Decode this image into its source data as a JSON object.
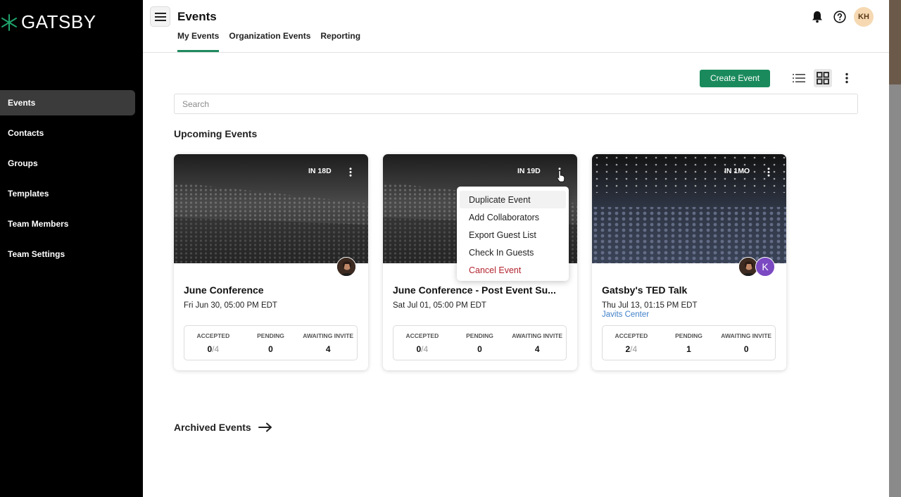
{
  "brand": {
    "name": "GATSBY",
    "accent": "#1a8a5c"
  },
  "sidebar": {
    "items": [
      {
        "label": "Events",
        "active": true
      },
      {
        "label": "Contacts"
      },
      {
        "label": "Groups"
      },
      {
        "label": "Templates"
      },
      {
        "label": "Team Members"
      },
      {
        "label": "Team Settings"
      }
    ]
  },
  "header": {
    "title": "Events",
    "tabs": [
      {
        "label": "My Events",
        "active": true
      },
      {
        "label": "Organization Events"
      },
      {
        "label": "Reporting"
      }
    ],
    "user_initials": "KH",
    "icons": [
      "menu-icon",
      "bell-icon",
      "help-icon"
    ]
  },
  "toolbar": {
    "create_label": "Create Event",
    "views": [
      "list-view-icon",
      "grid-view-icon",
      "more-icon"
    ],
    "active_view": "grid"
  },
  "search": {
    "placeholder": "Search",
    "value": ""
  },
  "upcoming": {
    "title": "Upcoming Events",
    "cards": [
      {
        "badge": "IN 18D",
        "title": "June Conference",
        "date": "Fri Jun 30, 05:00 PM EDT",
        "location": "",
        "avatars": [
          "photo"
        ],
        "stats": [
          {
            "label": "ACCEPTED",
            "value": "0",
            "total": "/4"
          },
          {
            "label": "PENDING",
            "value": "0"
          },
          {
            "label": "AWAITING INVITE",
            "value": "4"
          }
        ]
      },
      {
        "badge": "IN 19D",
        "title": "June Conference - Post Event Su...",
        "date": "Sat Jul 01, 05:00 PM EDT",
        "location": "",
        "avatars": [],
        "stats": [
          {
            "label": "ACCEPTED",
            "value": "0",
            "total": "/4"
          },
          {
            "label": "PENDING",
            "value": "0"
          },
          {
            "label": "AWAITING INVITE",
            "value": "4"
          }
        ]
      },
      {
        "badge": "IN 1MO",
        "title": "Gatsby's TED Talk",
        "date": "Thu Jul 13, 01:15 PM EDT",
        "location": "Javits Center",
        "avatars": [
          "photo",
          "K"
        ],
        "stats": [
          {
            "label": "ACCEPTED",
            "value": "2",
            "total": "/4"
          },
          {
            "label": "PENDING",
            "value": "1"
          },
          {
            "label": "AWAITING INVITE",
            "value": "0"
          }
        ]
      }
    ]
  },
  "context_menu": {
    "items": [
      {
        "label": "Duplicate Event"
      },
      {
        "label": "Add Collaborators"
      },
      {
        "label": "Export Guest List"
      },
      {
        "label": "Check In Guests"
      },
      {
        "label": "Cancel Event",
        "danger_color": "#b2252f"
      }
    ]
  },
  "archived": {
    "label": "Archived Events"
  }
}
